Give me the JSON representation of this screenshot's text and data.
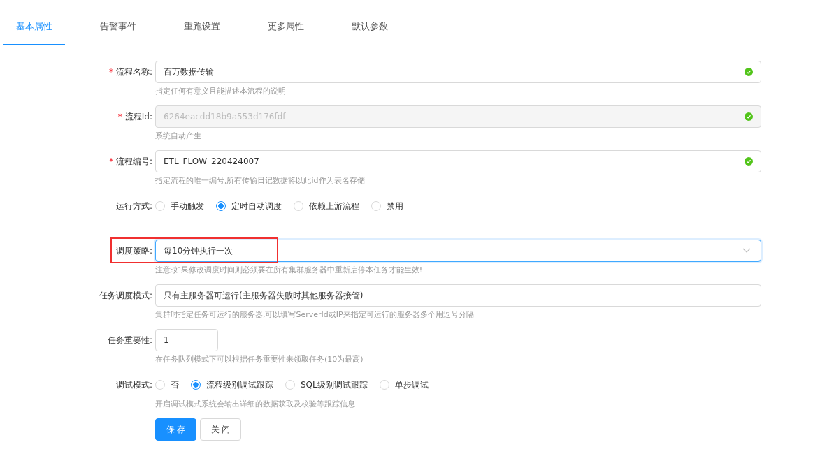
{
  "tabs": [
    {
      "label": "基本属性",
      "selected": true
    },
    {
      "label": "告警事件",
      "selected": false
    },
    {
      "label": "重跑设置",
      "selected": false
    },
    {
      "label": "更多属性",
      "selected": false
    },
    {
      "label": "默认参数",
      "selected": false
    }
  ],
  "form": {
    "items": [
      {
        "kind": "text",
        "label": "流程名称:",
        "required_mark": "*",
        "value": "百万数据传输",
        "disabled": false,
        "valid": true,
        "help": "指定任何有意义且能描述本流程的说明"
      },
      {
        "kind": "text",
        "label": "流程Id:",
        "required_mark": "*",
        "value": "6264eacdd18b9a553d176fdf",
        "disabled": true,
        "valid": true,
        "help": "系统自动产生"
      },
      {
        "kind": "text",
        "label": "流程编号:",
        "required_mark": "*",
        "value": "ETL_FLOW_220424007",
        "disabled": false,
        "valid": true,
        "help": "指定流程的唯一编号,所有传输日记数据将以此id作为表名存储"
      },
      {
        "kind": "radio",
        "label": "运行方式:",
        "options": [
          {
            "label": "手动触发",
            "selected": false
          },
          {
            "label": "定时自动调度",
            "selected": true
          },
          {
            "label": "依赖上游流程",
            "selected": false
          },
          {
            "label": "禁用",
            "selected": false
          }
        ]
      },
      {
        "kind": "select",
        "label": "调度策略:",
        "value": "每10分钟执行一次",
        "focused": true,
        "highlighted": true,
        "help": "注意:如果修改调度时间则必须要在所有集群服务器中重新启停本任务才能生效!"
      },
      {
        "kind": "text",
        "label": "任务调度模式:",
        "value": "只有主服务器可运行(主服务器失败时其他服务器接管)",
        "disabled": false,
        "help": "集群时指定任务可运行的服务器,可以填写ServerId或IP来指定可运行的服务器多个用逗号分隔"
      },
      {
        "kind": "number",
        "label": "任务重要性:",
        "value": "1",
        "help": "在任务队列模式下可以根据任务重要性来领取任务(10为最高)"
      },
      {
        "kind": "radio",
        "label": "调试模式:",
        "options": [
          {
            "label": "否",
            "selected": false
          },
          {
            "label": "流程级别调试跟踪",
            "selected": true
          },
          {
            "label": "SQL级别调试跟踪",
            "selected": false
          },
          {
            "label": "单步调试",
            "selected": false
          }
        ],
        "help": "开启调试模式系统会输出详细的数据获取及校验等跟踪信息"
      }
    ],
    "buttons": [
      {
        "label": "保 存",
        "kind": "primary"
      },
      {
        "label": "关 闭",
        "kind": "default"
      }
    ]
  }
}
